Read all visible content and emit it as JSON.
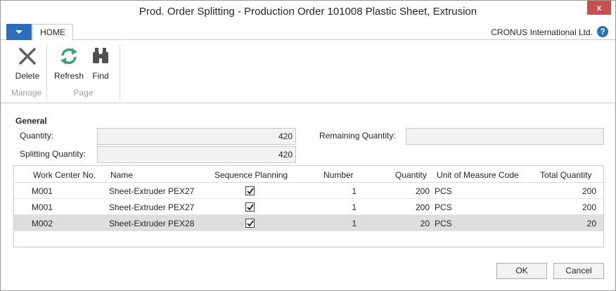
{
  "window": {
    "title": "Prod. Order Splitting - Production Order 101008 Plastic Sheet, Extrusion",
    "close_label": "x"
  },
  "ribbon": {
    "tab_home": "HOME",
    "company": "CRONUS International Ltd.",
    "help_label": "?",
    "groups": {
      "manage": "Manage",
      "page": "Page"
    },
    "buttons": {
      "delete": "Delete",
      "refresh": "Refresh",
      "find": "Find"
    }
  },
  "general": {
    "title": "General",
    "quantity_label": "Quantity:",
    "quantity_value": "420",
    "splitting_quantity_label": "Splitting Quantity:",
    "splitting_quantity_value": "420",
    "remaining_quantity_label": "Remaining Quantity:",
    "remaining_quantity_value": ""
  },
  "grid": {
    "columns": {
      "work_center_no": "Work Center No.",
      "name": "Name",
      "sequence_planning": "Sequence Planning",
      "number": "Number",
      "quantity": "Quantity",
      "uom_code": "Unit of Measure Code",
      "total_quantity": "Total Quantity"
    },
    "rows": [
      {
        "work_center_no": "M001",
        "name": "Sheet-Extruder PEX27",
        "sequence_planning": true,
        "number": "1",
        "quantity": "200",
        "uom_code": "PCS",
        "total_quantity": "200"
      },
      {
        "work_center_no": "M001",
        "name": "Sheet-Extruder PEX27",
        "sequence_planning": true,
        "number": "1",
        "quantity": "200",
        "uom_code": "PCS",
        "total_quantity": "200"
      },
      {
        "work_center_no": "M002",
        "name": "Sheet-Extruder PEX28",
        "sequence_planning": true,
        "number": "1",
        "quantity": "20",
        "uom_code": "PCS",
        "total_quantity": "20"
      }
    ]
  },
  "footer": {
    "ok_label": "OK",
    "cancel_label": "Cancel"
  },
  "colors": {
    "accent": "#2b6ebc",
    "close": "#c74f4f",
    "selected_row": "#dedede"
  }
}
